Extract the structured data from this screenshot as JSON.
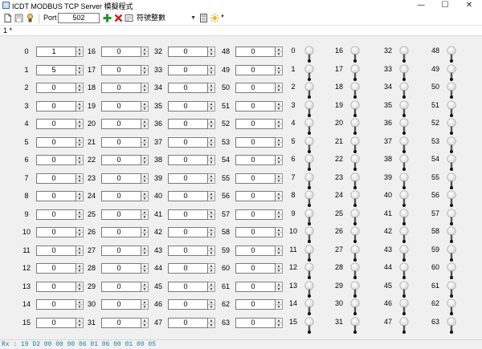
{
  "window": {
    "title": "ICDT MODBUS TCP Server 模擬程式",
    "minimize": "—",
    "maximize": "☐",
    "close": "✕"
  },
  "toolbar": {
    "port_label": "Port",
    "port_value": "502",
    "data_type": "符號整數",
    "icons": [
      "new-file-icon",
      "save-icon",
      "connection-icon",
      "add-icon",
      "delete-icon",
      "edit-icon",
      "calculator-icon",
      "sun-icon"
    ]
  },
  "tab": {
    "label": "1 *"
  },
  "registers": {
    "labels": [
      "0",
      "1",
      "2",
      "3",
      "4",
      "5",
      "6",
      "7",
      "8",
      "9",
      "10",
      "11",
      "12",
      "13",
      "14",
      "15",
      "16",
      "17",
      "18",
      "19",
      "20",
      "21",
      "22",
      "23",
      "24",
      "25",
      "26",
      "27",
      "28",
      "29",
      "30",
      "31",
      "32",
      "33",
      "34",
      "35",
      "36",
      "37",
      "38",
      "39",
      "40",
      "41",
      "42",
      "43",
      "44",
      "45",
      "46",
      "47",
      "48",
      "49",
      "50",
      "51",
      "52",
      "53",
      "54",
      "55",
      "56",
      "57",
      "58",
      "59",
      "60",
      "61",
      "62",
      "63"
    ],
    "values": [
      "1",
      "5",
      "0",
      "0",
      "0",
      "0",
      "0",
      "0",
      "0",
      "0",
      "0",
      "0",
      "0",
      "0",
      "0",
      "0",
      "0",
      "0",
      "0",
      "0",
      "0",
      "0",
      "0",
      "0",
      "0",
      "0",
      "0",
      "0",
      "0",
      "0",
      "0",
      "0",
      "0",
      "0",
      "0",
      "0",
      "0",
      "0",
      "0",
      "0",
      "0",
      "0",
      "0",
      "0",
      "0",
      "0",
      "0",
      "0",
      "0",
      "0",
      "0",
      "0",
      "0",
      "0",
      "0",
      "0",
      "0",
      "0",
      "0",
      "0",
      "0",
      "0",
      "0",
      "0"
    ]
  },
  "coils": {
    "labels": [
      "0",
      "1",
      "2",
      "3",
      "4",
      "5",
      "6",
      "7",
      "8",
      "9",
      "10",
      "11",
      "12",
      "13",
      "14",
      "15",
      "16",
      "17",
      "18",
      "19",
      "20",
      "21",
      "22",
      "23",
      "24",
      "25",
      "26",
      "27",
      "28",
      "29",
      "30",
      "31",
      "32",
      "33",
      "34",
      "35",
      "36",
      "37",
      "38",
      "39",
      "40",
      "41",
      "42",
      "43",
      "44",
      "45",
      "46",
      "47",
      "48",
      "49",
      "50",
      "51",
      "52",
      "53",
      "54",
      "55",
      "56",
      "57",
      "58",
      "59",
      "60",
      "61",
      "62",
      "63"
    ],
    "states": [
      "off",
      "off",
      "off",
      "off",
      "off",
      "off",
      "off",
      "off",
      "off",
      "off",
      "off",
      "off",
      "off",
      "off",
      "off",
      "off",
      "off",
      "off",
      "off",
      "off",
      "off",
      "off",
      "off",
      "off",
      "off",
      "off",
      "off",
      "off",
      "off",
      "off",
      "off",
      "off",
      "off",
      "off",
      "off",
      "off",
      "off",
      "off",
      "off",
      "off",
      "off",
      "off",
      "off",
      "off",
      "off",
      "off",
      "off",
      "off",
      "off",
      "off",
      "off",
      "off",
      "off",
      "off",
      "off",
      "off",
      "off",
      "off",
      "off",
      "off",
      "off",
      "off",
      "off",
      "off"
    ]
  },
  "status": {
    "text": "Rx : 19 D2 00 00 00 06 01 06 00 01 00 05"
  },
  "colors": {
    "status_text": "#1f7ea1",
    "add_icon": "#1a9a1a",
    "delete_icon": "#c81e1e",
    "bulb_off": "#d8d8d8"
  }
}
